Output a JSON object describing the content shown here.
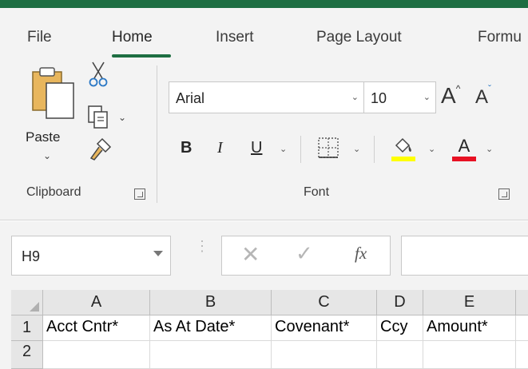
{
  "ribbon": {
    "tabs": [
      {
        "label": "File"
      },
      {
        "label": "Home"
      },
      {
        "label": "Insert"
      },
      {
        "label": "Page Layout"
      },
      {
        "label": "Formu"
      }
    ],
    "active_tab": "Home",
    "clipboard": {
      "paste_label": "Paste",
      "group_label": "Clipboard",
      "icons": [
        "paste-icon",
        "cut-icon",
        "copy-icon",
        "format-painter-icon"
      ]
    },
    "font": {
      "font_name": "Arial",
      "font_size": "10",
      "group_label": "Font",
      "bold": "B",
      "italic": "I",
      "underline": "U",
      "grow_letter": "A",
      "shrink_letter": "A",
      "font_color_letter": "A",
      "highlight_color": "#ffff00",
      "font_color": "#e81123"
    }
  },
  "formula_bar": {
    "name_box": "H9",
    "fx_label": "fx",
    "cancel_symbol": "✕",
    "enter_symbol": "✓",
    "formula": ""
  },
  "sheet": {
    "columns": [
      "A",
      "B",
      "C",
      "D",
      "E"
    ],
    "rows": [
      {
        "header": "1",
        "cells": [
          "Acct Cntr*",
          "As At Date*",
          "Covenant*",
          "Ccy",
          "Amount*"
        ]
      },
      {
        "header": "2",
        "cells": [
          "",
          "",
          "",
          "",
          ""
        ]
      }
    ]
  },
  "colors": {
    "accent": "#1e6e42",
    "ribbon_bg": "#f3f3f3"
  }
}
